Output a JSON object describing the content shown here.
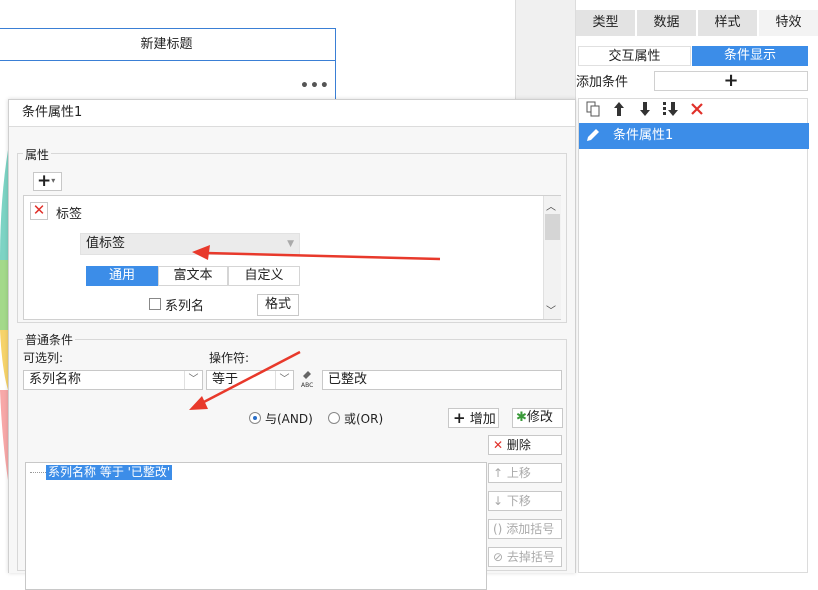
{
  "canvas": {
    "title_text": "新建标题",
    "more_icon": "•••"
  },
  "right_panel": {
    "tabs": [
      {
        "label": "类型"
      },
      {
        "label": "数据"
      },
      {
        "label": "样式"
      },
      {
        "label": "特效"
      }
    ],
    "sub_tabs": [
      {
        "label": "交互属性"
      },
      {
        "label": "条件显示"
      }
    ],
    "add_condition_label": "添加条件",
    "add_condition_plus": "+",
    "toolbar_icons": [
      "copy-icon",
      "arrow-up-icon",
      "arrow-down-icon",
      "move-bottom-icon",
      "delete-icon"
    ],
    "condition_item": "条件属性1"
  },
  "dialog": {
    "title": "条件属性1",
    "attributes_group": "属性",
    "add_btn": "+",
    "label_name": "标签",
    "value_select": "值标签",
    "seg_tabs": [
      {
        "label": "通用"
      },
      {
        "label": "富文本"
      },
      {
        "label": "自定义"
      }
    ],
    "series_name_checkbox": "系列名",
    "format_btn": "格式",
    "normal_cond_group": "普通条件",
    "optional_col_label": "可选列:",
    "operator_label": "操作符:",
    "column_value": "系列名称",
    "operator_value": "等于",
    "cond_value": "已整改",
    "and_label": "与(AND)",
    "or_label": "或(OR)",
    "add_label": "增加",
    "modify_label": "修改",
    "delete_label": "删除",
    "move_up_label": "上移",
    "move_down_label": "下移",
    "add_bracket_label": "添加括号",
    "remove_bracket_label": "去掉括号",
    "condition_text": "系列名称 等于 '已整改'"
  },
  "colors": {
    "accent": "#3c8de8",
    "delete_red": "#e0302a",
    "annotation_arrow": "#e8392b"
  }
}
